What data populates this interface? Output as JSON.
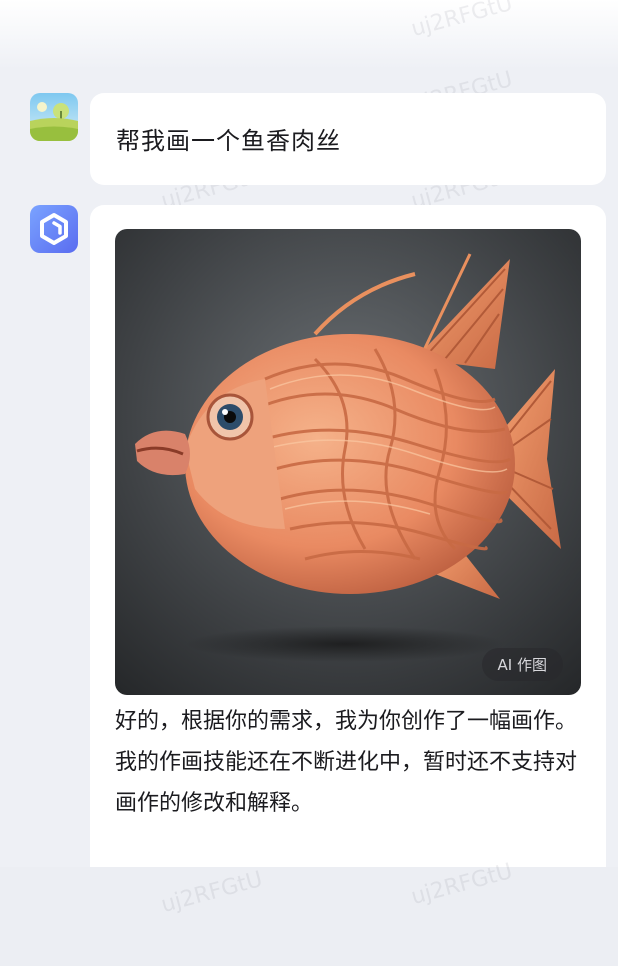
{
  "chat": {
    "user": {
      "message": "帮我画一个鱼香肉丝"
    },
    "assistant": {
      "image_badge": "AI 作图",
      "reply_paragraphs": [
        "好的，根据你的需求，我为你创作了一幅画作。",
        "我的作画技能还在不断进化中，暂时还不支持对画作的修改和解释。"
      ]
    }
  },
  "watermark": "uj2RFGtU",
  "colors": {
    "page_bg": "#eef0f5",
    "bubble_bg": "#ffffff",
    "text": "#1b1b1f",
    "bot_avatar": "#6a84f5",
    "fish": "#e98a62"
  },
  "icons": {
    "user_avatar": "landscape-avatar-icon",
    "bot_avatar": "hexagon-logo-icon"
  }
}
